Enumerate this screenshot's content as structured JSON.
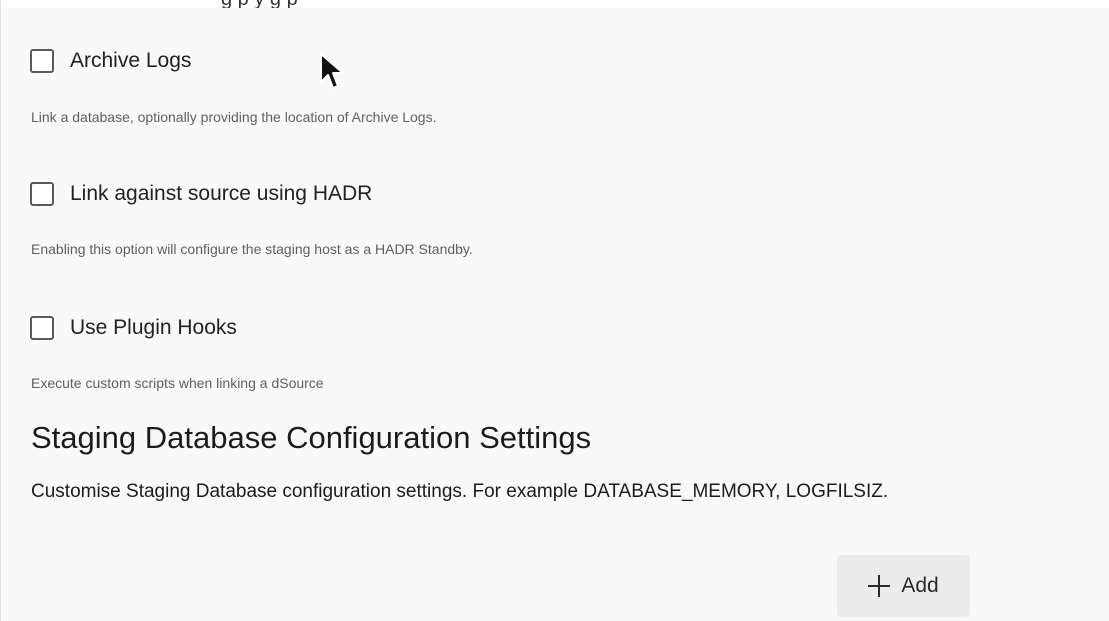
{
  "options": [
    {
      "label": "Archive Logs",
      "checked": false,
      "description": "Link a database, optionally providing the location of Archive Logs."
    },
    {
      "label": "Link against source using HADR",
      "checked": false,
      "description": "Enabling this option will configure the staging host as a HADR Standby."
    },
    {
      "label": "Use Plugin Hooks",
      "checked": false,
      "description": "Execute custom scripts when linking a dSource"
    }
  ],
  "staging_section": {
    "title": "Staging Database Configuration Settings",
    "description": "Customise Staging Database configuration settings. For example DATABASE_MEMORY, LOGFILSIZ."
  },
  "add_button": {
    "label": "Add",
    "icon": "plus-icon"
  },
  "colors": {
    "background": "#f9f9f9",
    "button_background": "#ececec",
    "text": "#222222",
    "helper_text": "#5f5f5f"
  }
}
